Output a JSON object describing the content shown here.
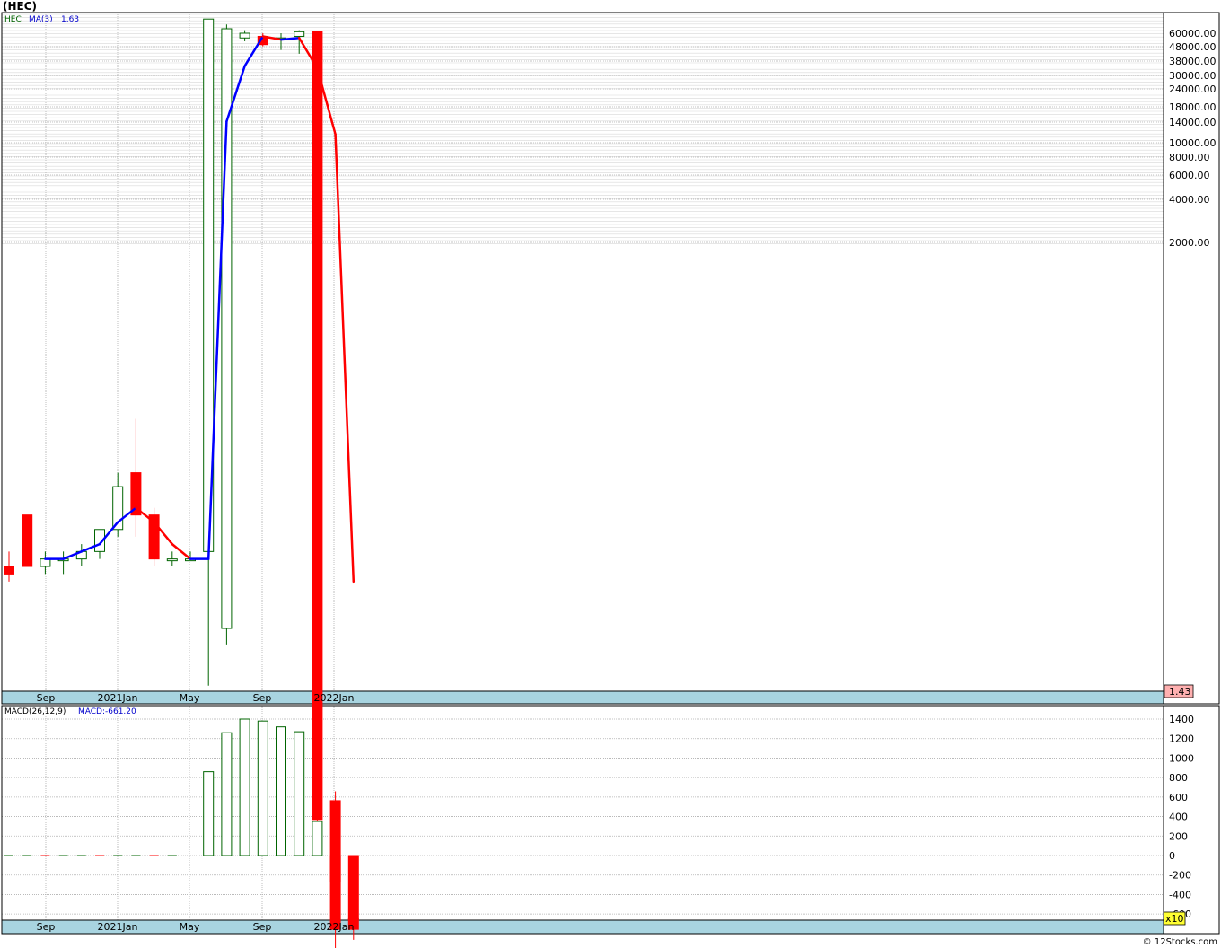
{
  "title": "(HEC)",
  "footer": "© 12Stocks.com",
  "colors": {
    "up": "#006400",
    "down": "#ff0000",
    "ma": "#0000ff",
    "axis_band": "#a8d4e0",
    "last_price_bg": "#ffb0b0",
    "x10_bg": "#ffff33"
  },
  "price_panel": {
    "legend": {
      "symbol": "HEC",
      "ma_label": "MA(3)",
      "ma_value": "1.63"
    },
    "last_price_label": "1.43",
    "x_ticks": [
      "Sep",
      "2021Jan",
      "May",
      "Sep",
      "2022Jan"
    ],
    "y_ticks": [
      "60000.00",
      "48000.00",
      "38000.00",
      "30000.00",
      "24000.00",
      "18000.00",
      "14000.00",
      "10000.00",
      "8000.00",
      "6000.00",
      "4000.00",
      "2000.00"
    ]
  },
  "macd_panel": {
    "legend": {
      "name": "MACD(26,12,9)",
      "value_label": "MACD:-661.20"
    },
    "multiplier_label": "x10",
    "x_ticks": [
      "Sep",
      "2021Jan",
      "May",
      "Sep",
      "2022Jan"
    ],
    "y_ticks": [
      "1400",
      "1200",
      "1000",
      "800",
      "600",
      "400",
      "200",
      "0",
      "-200",
      "-400",
      "-600"
    ]
  },
  "chart_data": {
    "type": "candlestick",
    "title": "(HEC)",
    "y_scale": "log",
    "ma_period": 3,
    "candles": [
      {
        "o": 1.45,
        "h": 1.47,
        "l": 1.43,
        "c": 1.44
      },
      {
        "o": 1.52,
        "h": 1.52,
        "l": 1.45,
        "c": 1.45
      },
      {
        "o": 1.45,
        "h": 1.47,
        "l": 1.44,
        "c": 1.46
      },
      {
        "o": 1.46,
        "h": 1.47,
        "l": 1.44,
        "c": 1.46
      },
      {
        "o": 1.46,
        "h": 1.48,
        "l": 1.45,
        "c": 1.47
      },
      {
        "o": 1.47,
        "h": 1.5,
        "l": 1.46,
        "c": 1.5
      },
      {
        "o": 1.5,
        "h": 1.58,
        "l": 1.49,
        "c": 1.56
      },
      {
        "o": 1.58,
        "h": 1.66,
        "l": 1.49,
        "c": 1.52
      },
      {
        "o": 1.52,
        "h": 1.53,
        "l": 1.45,
        "c": 1.46
      },
      {
        "o": 1.46,
        "h": 1.47,
        "l": 1.45,
        "c": 1.46
      },
      {
        "o": 1.46,
        "h": 1.47,
        "l": 1.46,
        "c": 1.46
      },
      {
        "o": 1.47,
        "h": 70000,
        "l": 1.3,
        "c": 70000
      },
      {
        "o": 1.37,
        "h": 66000,
        "l": 1.35,
        "c": 63000
      },
      {
        "o": 57000,
        "h": 62000,
        "l": 55000,
        "c": 60000
      },
      {
        "o": 58000,
        "h": 60000,
        "l": 52000,
        "c": 53000
      },
      {
        "o": 56000,
        "h": 60000,
        "l": 50000,
        "c": 57000
      },
      {
        "o": 58000,
        "h": 62000,
        "l": 48000,
        "c": 61000
      },
      {
        "o": 61000,
        "h": 61000,
        "l": 1.13,
        "c": 1.15
      },
      {
        "o": 1.17,
        "h": 1.18,
        "l": 1.02,
        "c": 1.04
      },
      {
        "o": 1.05,
        "h": 1.06,
        "l": 1.03,
        "c": 1.04
      }
    ],
    "ma": [
      null,
      null,
      1.46,
      1.46,
      1.47,
      1.48,
      1.51,
      1.53,
      1.51,
      1.48,
      1.46,
      1.46,
      23000,
      42000,
      58000,
      56000,
      57000,
      41000,
      20000,
      1.43
    ],
    "macd_hist": [
      0,
      0,
      0,
      0,
      0,
      0,
      0,
      0,
      0,
      0,
      null,
      860,
      1260,
      1400,
      1380,
      1320,
      1270,
      350,
      -270,
      -661
    ]
  }
}
